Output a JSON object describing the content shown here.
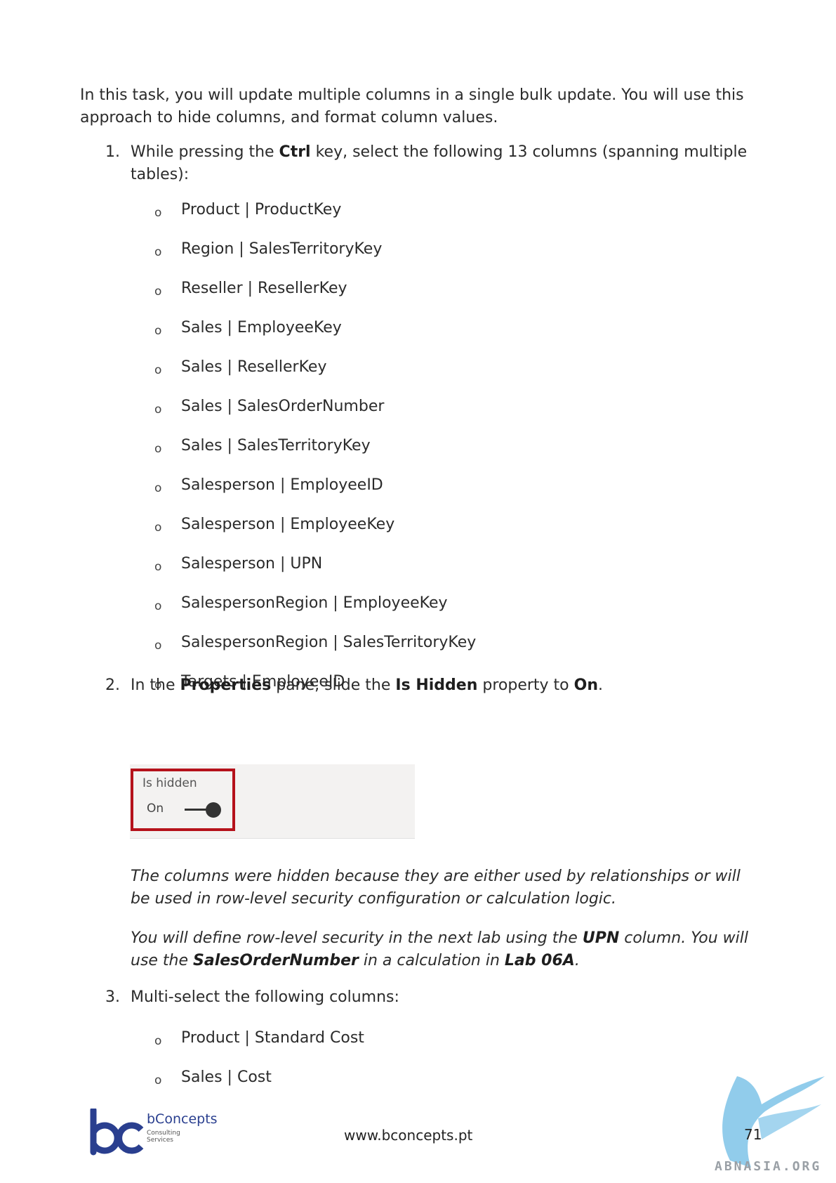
{
  "intro": "In this task, you will update multiple columns in a single bulk update. You will use this approach to hide columns, and format column values.",
  "steps": [
    {
      "number": "1.",
      "text_pre": "While pressing the ",
      "text_bold": "Ctrl",
      "text_post": " key, select the following 13 columns (spanning multiple tables):",
      "items": [
        "Product | ProductKey",
        "Region | SalesTerritoryKey",
        "Reseller | ResellerKey",
        "Sales | EmployeeKey",
        "Sales | ResellerKey",
        "Sales | SalesOrderNumber",
        "Sales | SalesTerritoryKey",
        "Salesperson | EmployeeID",
        "Salesperson | EmployeeKey",
        "Salesperson | UPN",
        "SalespersonRegion | EmployeeKey",
        "SalespersonRegion | SalesTerritoryKey",
        "Targets | EmployeeID"
      ]
    },
    {
      "number": "2.",
      "parts": [
        "In the ",
        "Properties",
        " pane, slide the ",
        "Is Hidden",
        " property to ",
        "On",
        "."
      ],
      "screenshot": {
        "label": "Is hidden",
        "value": "On",
        "state": "on"
      }
    },
    {
      "number": "3.",
      "text": "Multi-select the following columns:",
      "items": [
        "Product | Standard Cost",
        "Sales | Cost"
      ]
    }
  ],
  "note1": "The columns were hidden because they are either used by relationships or will be used in row-level security configuration or calculation logic.",
  "note2_parts": [
    "You will define row-level security in the next lab using the ",
    "UPN",
    " column. You will use the ",
    "SalesOrderNumber",
    " in a calculation in ",
    "Lab 06A",
    "."
  ],
  "bullet_glyph": "o",
  "footer": {
    "logo_name": "bConcepts",
    "logo_sub1": "Consulting",
    "logo_sub2": "Services",
    "url": "www.bconcepts.pt",
    "page_number": "71",
    "watermark": "ABNASIA.ORG"
  },
  "colors": {
    "highlight_frame": "#b5121b",
    "logo_blue": "#2a3f8f",
    "watermark_blue": "#7ec3e8"
  }
}
